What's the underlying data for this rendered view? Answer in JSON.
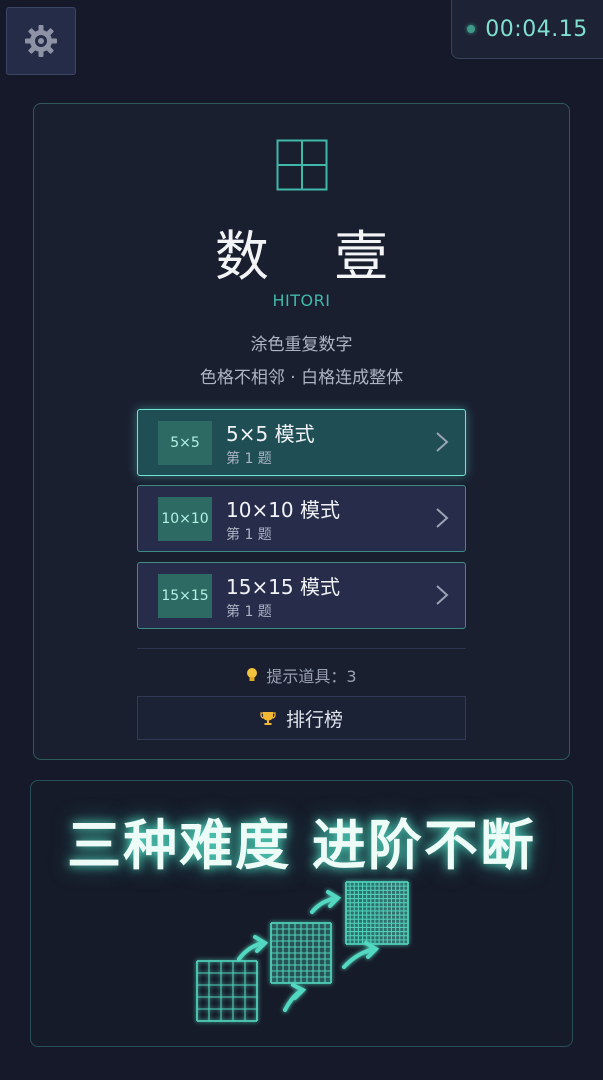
{
  "timer": {
    "value": "00:04.15"
  },
  "game": {
    "title": "数 壹",
    "subtitle": "HITORI",
    "desc_line1": "涂色重复数字",
    "desc_line2": "色格不相邻 · 白格连成整体"
  },
  "modes": [
    {
      "badge": "5×5",
      "name": "5×5 模式",
      "level": "第 1 题",
      "active": true
    },
    {
      "badge": "10×10",
      "name": "10×10 模式",
      "level": "第 1 题",
      "active": false
    },
    {
      "badge": "15×15",
      "name": "15×15 模式",
      "level": "第 1 题",
      "active": false
    }
  ],
  "hint": {
    "label": "提示道具：3"
  },
  "leaderboard": {
    "label": "排行榜"
  },
  "promo": {
    "title": "三种难度 进阶不断"
  },
  "colors": {
    "accent": "#3fb8a8",
    "background": "#16192a",
    "glow": "#6fe5d5"
  },
  "icons": [
    "gear-icon",
    "timer-dot-icon",
    "grid-logo-icon",
    "chevron-right-icon",
    "lightbulb-icon",
    "trophy-icon"
  ]
}
